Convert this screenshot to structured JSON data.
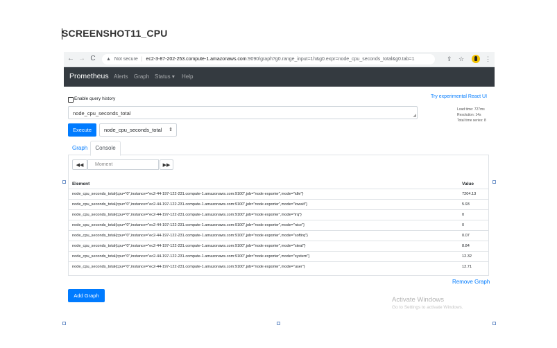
{
  "document": {
    "title": "SCREENSHOT11_CPU"
  },
  "browser": {
    "back_icon": "←",
    "forward_icon": "→",
    "reload_icon": "C",
    "warning_icon": "▲",
    "not_secure": "Not secure",
    "separator": "|",
    "host": "ec2-3-87-202-253.compute-1.amazonaws.com",
    "path": ":9090/graph?g0.range_input=1h&g0.expr=node_cpu_seconds_total&g0.tab=1",
    "share_icon": "⇪",
    "star_icon": "☆",
    "menu_icon": "⋮"
  },
  "navbar": {
    "brand": "Prometheus",
    "links": [
      "Alerts",
      "Graph",
      "Status ▾",
      "Help"
    ]
  },
  "page": {
    "query_history_label": "Enable query history",
    "react_link": "Try experimental React UI",
    "query_value": "node_cpu_seconds_total",
    "stats": [
      "Load time: 727ms",
      "Resolution: 14s",
      "Total time series: 8"
    ],
    "execute_label": "Execute",
    "metric_select_value": "node_cpu_seconds_total",
    "metric_select_caret": "⇕",
    "tabs": [
      "Graph",
      "Console"
    ],
    "back_button": "◀◀",
    "moment_placeholder": "Moment",
    "forward_button": "▶▶",
    "table": {
      "headers": [
        "Element",
        "Value"
      ],
      "rows": [
        {
          "element": "node_cpu_seconds_total{cpu=\"0\",instance=\"ec2-44-197-122-231.compute-1.amazonaws.com:9100\",job=\"node exporter\",mode=\"idle\"}",
          "value": "7204.13"
        },
        {
          "element": "node_cpu_seconds_total{cpu=\"0\",instance=\"ec2-44-197-122-231.compute-1.amazonaws.com:9100\",job=\"node exporter\",mode=\"iowait\"}",
          "value": "5.93"
        },
        {
          "element": "node_cpu_seconds_total{cpu=\"0\",instance=\"ec2-44-197-122-231.compute-1.amazonaws.com:9100\",job=\"node exporter\",mode=\"irq\"}",
          "value": "0"
        },
        {
          "element": "node_cpu_seconds_total{cpu=\"0\",instance=\"ec2-44-197-122-231.compute-1.amazonaws.com:9100\",job=\"node exporter\",mode=\"nice\"}",
          "value": "0"
        },
        {
          "element": "node_cpu_seconds_total{cpu=\"0\",instance=\"ec2-44-197-122-231.compute-1.amazonaws.com:9100\",job=\"node exporter\",mode=\"softirq\"}",
          "value": "0.07"
        },
        {
          "element": "node_cpu_seconds_total{cpu=\"0\",instance=\"ec2-44-197-122-231.compute-1.amazonaws.com:9100\",job=\"node exporter\",mode=\"steal\"}",
          "value": "8.84"
        },
        {
          "element": "node_cpu_seconds_total{cpu=\"0\",instance=\"ec2-44-197-122-231.compute-1.amazonaws.com:9100\",job=\"node exporter\",mode=\"system\"}",
          "value": "12.32"
        },
        {
          "element": "node_cpu_seconds_total{cpu=\"0\",instance=\"ec2-44-197-122-231.compute-1.amazonaws.com:9100\",job=\"node exporter\",mode=\"user\"}",
          "value": "12.71"
        }
      ]
    },
    "remove_graph_label": "Remove Graph",
    "add_graph_label": "Add Graph"
  },
  "watermark": {
    "line1": "Activate Windows",
    "line2": "Go to Settings to activate Windows."
  },
  "colors": {
    "accent": "#007bff",
    "navbar": "#343a40",
    "chrome": "#f1f3f4"
  }
}
